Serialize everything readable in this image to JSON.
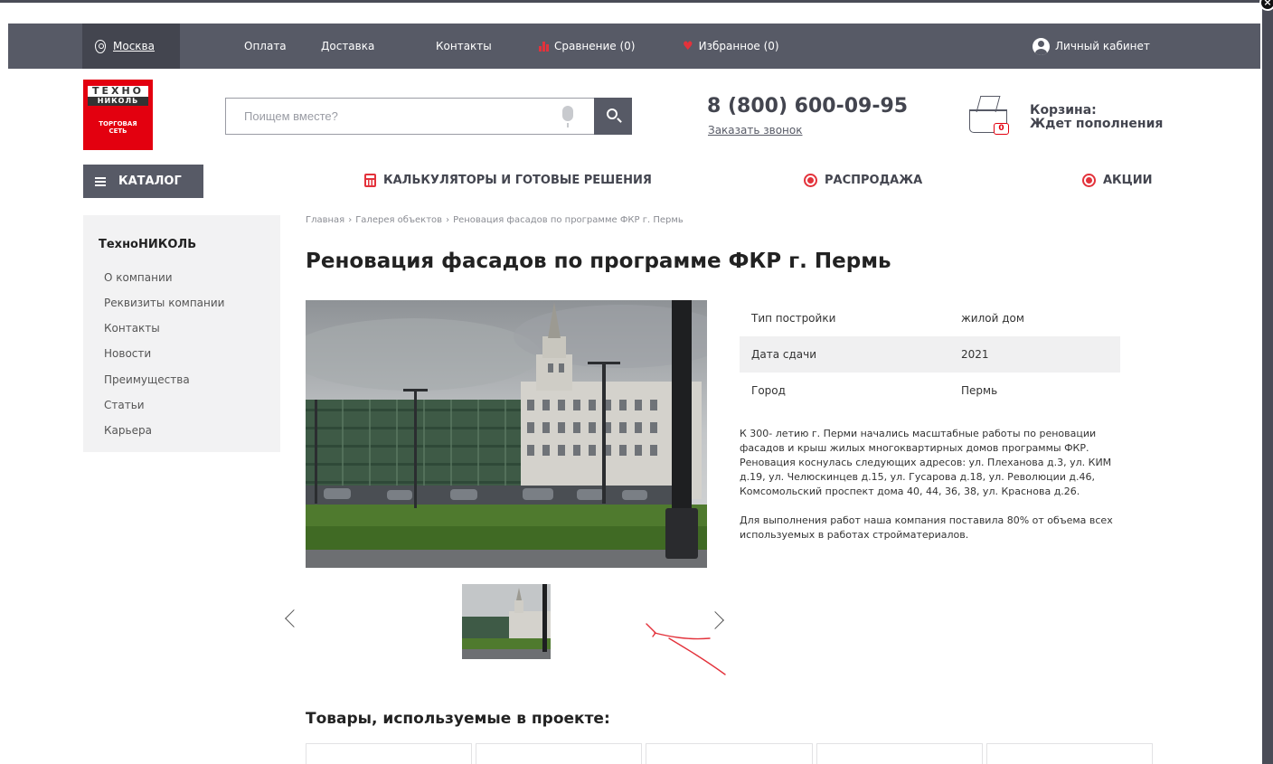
{
  "topbar": {
    "city": "Москва",
    "links": [
      "Оплата",
      "Доставка",
      "Контакты"
    ],
    "compare": "Сравнение (0)",
    "favorites": "Избранное (0)",
    "account": "Личный кабинет"
  },
  "logo": {
    "line1": "ТЕХНО",
    "line2": "НИКОЛЬ",
    "line3": "ТОРГОВАЯ",
    "line4": "СЕТЬ"
  },
  "search": {
    "placeholder": "Поищем вместе?"
  },
  "contact": {
    "phone": "8 (800) 600-09-95",
    "callback": "Заказать звонок"
  },
  "cart": {
    "count": "0",
    "title": "Корзина:",
    "status": "Ждет пополнения"
  },
  "nav": {
    "catalog": "КАТАЛОГ",
    "calculators": "КАЛЬКУЛЯТОРЫ И ГОТОВЫЕ РЕШЕНИЯ",
    "sale": "РАСПРОДАЖА",
    "promo": "АКЦИИ"
  },
  "sidebar": {
    "title": "ТехноНИКОЛЬ",
    "items": [
      "О компании",
      "Реквизиты компании",
      "Контакты",
      "Новости",
      "Преимущества",
      "Статьи",
      "Карьера"
    ]
  },
  "breadcrumb": [
    "Главная",
    "Галерея объектов",
    "Реновация фасадов по программе ФКР г. Пермь"
  ],
  "page": {
    "title": "Реновация фасадов по программе ФКР г. Пермь",
    "properties": [
      {
        "key": "Тип постройки",
        "value": "жилой дом"
      },
      {
        "key": "Дата сдачи",
        "value": "2021"
      },
      {
        "key": "Город",
        "value": "Пермь"
      }
    ],
    "description": [
      "К 300- летию г. Перми начались масштабные работы по реновации фасадов и крыш жилых многоквартирных домов программы ФКР. Реновация коснулась следующих адресов: ул. Плеханова д.3, ул. КИМ д.19, ул. Челюскинцев д.15, ул. Гусарова д.18, ул. Революции д.46, Комсомольский проспект дома 40, 44, 36, 38, ул. Краснова д.26.",
      "Для выполнения работ наша компания поставила 80% от объема всех используемых в работах стройматериалов."
    ],
    "products_title": "Товары, используемые в проекте:"
  },
  "colors": {
    "topbar": "#575a66",
    "accent": "#e3000f",
    "text": "#222222"
  },
  "icons": [
    "location-pin-icon",
    "compare-bars-icon",
    "heart-icon",
    "user-icon",
    "microphone-icon",
    "search-icon",
    "basket-icon",
    "menu-icon",
    "calculator-icon",
    "sale-badge-icon",
    "percent-badge-icon",
    "chevron-left-icon",
    "chevron-right-icon"
  ]
}
